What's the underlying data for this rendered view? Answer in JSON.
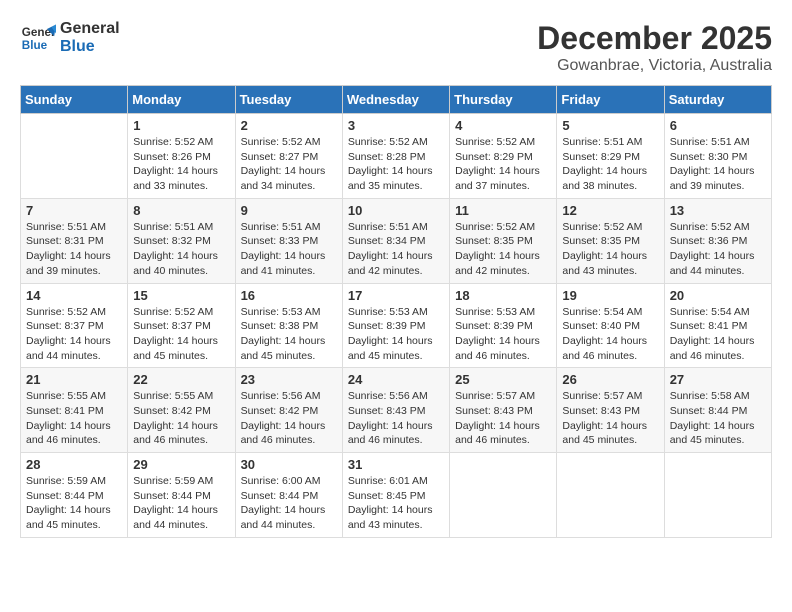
{
  "header": {
    "logo_line1": "General",
    "logo_line2": "Blue",
    "month_title": "December 2025",
    "subtitle": "Gowanbrae, Victoria, Australia"
  },
  "calendar": {
    "days_of_week": [
      "Sunday",
      "Monday",
      "Tuesday",
      "Wednesday",
      "Thursday",
      "Friday",
      "Saturday"
    ],
    "weeks": [
      [
        {
          "day": "",
          "info": ""
        },
        {
          "day": "1",
          "info": "Sunrise: 5:52 AM\nSunset: 8:26 PM\nDaylight: 14 hours\nand 33 minutes."
        },
        {
          "day": "2",
          "info": "Sunrise: 5:52 AM\nSunset: 8:27 PM\nDaylight: 14 hours\nand 34 minutes."
        },
        {
          "day": "3",
          "info": "Sunrise: 5:52 AM\nSunset: 8:28 PM\nDaylight: 14 hours\nand 35 minutes."
        },
        {
          "day": "4",
          "info": "Sunrise: 5:52 AM\nSunset: 8:29 PM\nDaylight: 14 hours\nand 37 minutes."
        },
        {
          "day": "5",
          "info": "Sunrise: 5:51 AM\nSunset: 8:29 PM\nDaylight: 14 hours\nand 38 minutes."
        },
        {
          "day": "6",
          "info": "Sunrise: 5:51 AM\nSunset: 8:30 PM\nDaylight: 14 hours\nand 39 minutes."
        }
      ],
      [
        {
          "day": "7",
          "info": "Sunrise: 5:51 AM\nSunset: 8:31 PM\nDaylight: 14 hours\nand 39 minutes."
        },
        {
          "day": "8",
          "info": "Sunrise: 5:51 AM\nSunset: 8:32 PM\nDaylight: 14 hours\nand 40 minutes."
        },
        {
          "day": "9",
          "info": "Sunrise: 5:51 AM\nSunset: 8:33 PM\nDaylight: 14 hours\nand 41 minutes."
        },
        {
          "day": "10",
          "info": "Sunrise: 5:51 AM\nSunset: 8:34 PM\nDaylight: 14 hours\nand 42 minutes."
        },
        {
          "day": "11",
          "info": "Sunrise: 5:52 AM\nSunset: 8:35 PM\nDaylight: 14 hours\nand 42 minutes."
        },
        {
          "day": "12",
          "info": "Sunrise: 5:52 AM\nSunset: 8:35 PM\nDaylight: 14 hours\nand 43 minutes."
        },
        {
          "day": "13",
          "info": "Sunrise: 5:52 AM\nSunset: 8:36 PM\nDaylight: 14 hours\nand 44 minutes."
        }
      ],
      [
        {
          "day": "14",
          "info": "Sunrise: 5:52 AM\nSunset: 8:37 PM\nDaylight: 14 hours\nand 44 minutes."
        },
        {
          "day": "15",
          "info": "Sunrise: 5:52 AM\nSunset: 8:37 PM\nDaylight: 14 hours\nand 45 minutes."
        },
        {
          "day": "16",
          "info": "Sunrise: 5:53 AM\nSunset: 8:38 PM\nDaylight: 14 hours\nand 45 minutes."
        },
        {
          "day": "17",
          "info": "Sunrise: 5:53 AM\nSunset: 8:39 PM\nDaylight: 14 hours\nand 45 minutes."
        },
        {
          "day": "18",
          "info": "Sunrise: 5:53 AM\nSunset: 8:39 PM\nDaylight: 14 hours\nand 46 minutes."
        },
        {
          "day": "19",
          "info": "Sunrise: 5:54 AM\nSunset: 8:40 PM\nDaylight: 14 hours\nand 46 minutes."
        },
        {
          "day": "20",
          "info": "Sunrise: 5:54 AM\nSunset: 8:41 PM\nDaylight: 14 hours\nand 46 minutes."
        }
      ],
      [
        {
          "day": "21",
          "info": "Sunrise: 5:55 AM\nSunset: 8:41 PM\nDaylight: 14 hours\nand 46 minutes."
        },
        {
          "day": "22",
          "info": "Sunrise: 5:55 AM\nSunset: 8:42 PM\nDaylight: 14 hours\nand 46 minutes."
        },
        {
          "day": "23",
          "info": "Sunrise: 5:56 AM\nSunset: 8:42 PM\nDaylight: 14 hours\nand 46 minutes."
        },
        {
          "day": "24",
          "info": "Sunrise: 5:56 AM\nSunset: 8:43 PM\nDaylight: 14 hours\nand 46 minutes."
        },
        {
          "day": "25",
          "info": "Sunrise: 5:57 AM\nSunset: 8:43 PM\nDaylight: 14 hours\nand 46 minutes."
        },
        {
          "day": "26",
          "info": "Sunrise: 5:57 AM\nSunset: 8:43 PM\nDaylight: 14 hours\nand 45 minutes."
        },
        {
          "day": "27",
          "info": "Sunrise: 5:58 AM\nSunset: 8:44 PM\nDaylight: 14 hours\nand 45 minutes."
        }
      ],
      [
        {
          "day": "28",
          "info": "Sunrise: 5:59 AM\nSunset: 8:44 PM\nDaylight: 14 hours\nand 45 minutes."
        },
        {
          "day": "29",
          "info": "Sunrise: 5:59 AM\nSunset: 8:44 PM\nDaylight: 14 hours\nand 44 minutes."
        },
        {
          "day": "30",
          "info": "Sunrise: 6:00 AM\nSunset: 8:44 PM\nDaylight: 14 hours\nand 44 minutes."
        },
        {
          "day": "31",
          "info": "Sunrise: 6:01 AM\nSunset: 8:45 PM\nDaylight: 14 hours\nand 43 minutes."
        },
        {
          "day": "",
          "info": ""
        },
        {
          "day": "",
          "info": ""
        },
        {
          "day": "",
          "info": ""
        }
      ]
    ]
  }
}
